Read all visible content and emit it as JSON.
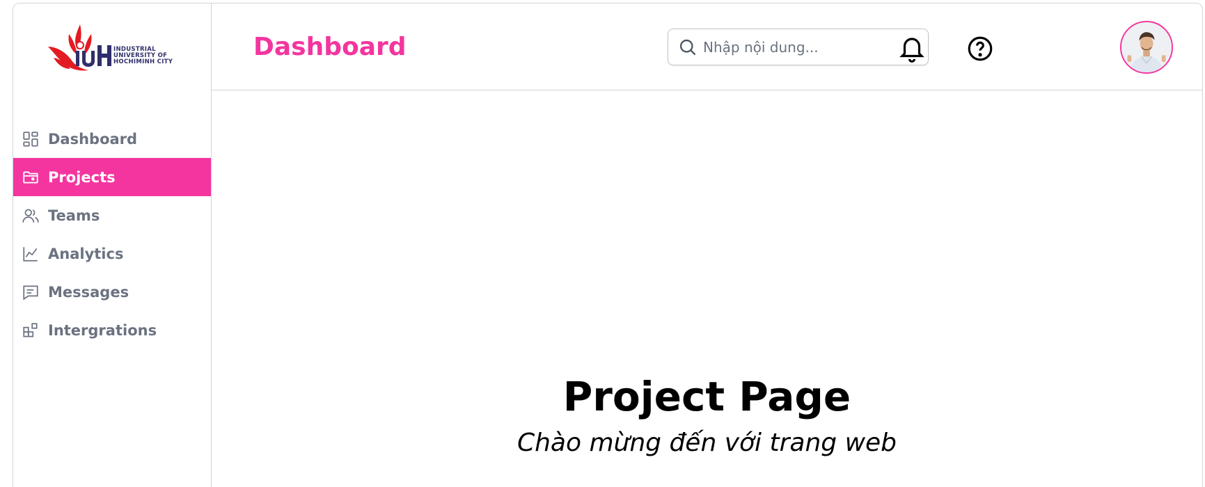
{
  "logo": {
    "line1": "INDUSTRIAL",
    "line2": "UNIVERSITY OF",
    "line3": "HOCHIMINH CITY",
    "mark": "IUH",
    "colors": {
      "red": "#e31b23",
      "navy": "#2f2f6b"
    }
  },
  "sidebar": {
    "items": [
      {
        "label": "Dashboard",
        "icon": "dashboard-grid-icon",
        "active": false
      },
      {
        "label": "Projects",
        "icon": "folder-icon",
        "active": true
      },
      {
        "label": "Teams",
        "icon": "users-icon",
        "active": false
      },
      {
        "label": "Analytics",
        "icon": "line-chart-icon",
        "active": false
      },
      {
        "label": "Messages",
        "icon": "message-icon",
        "active": false
      },
      {
        "label": "Intergrations",
        "icon": "integrations-icon",
        "active": false
      }
    ]
  },
  "header": {
    "title": "Dashboard",
    "search": {
      "placeholder": "Nhập nội dung...",
      "value": ""
    },
    "icons": [
      "bell-icon",
      "help-icon"
    ]
  },
  "main": {
    "title": "Project Page",
    "subtitle": "Chào mừng đến với trang web"
  },
  "colors": {
    "accent": "#f4359f",
    "muted": "#6b7280",
    "border": "#cfd3da"
  }
}
